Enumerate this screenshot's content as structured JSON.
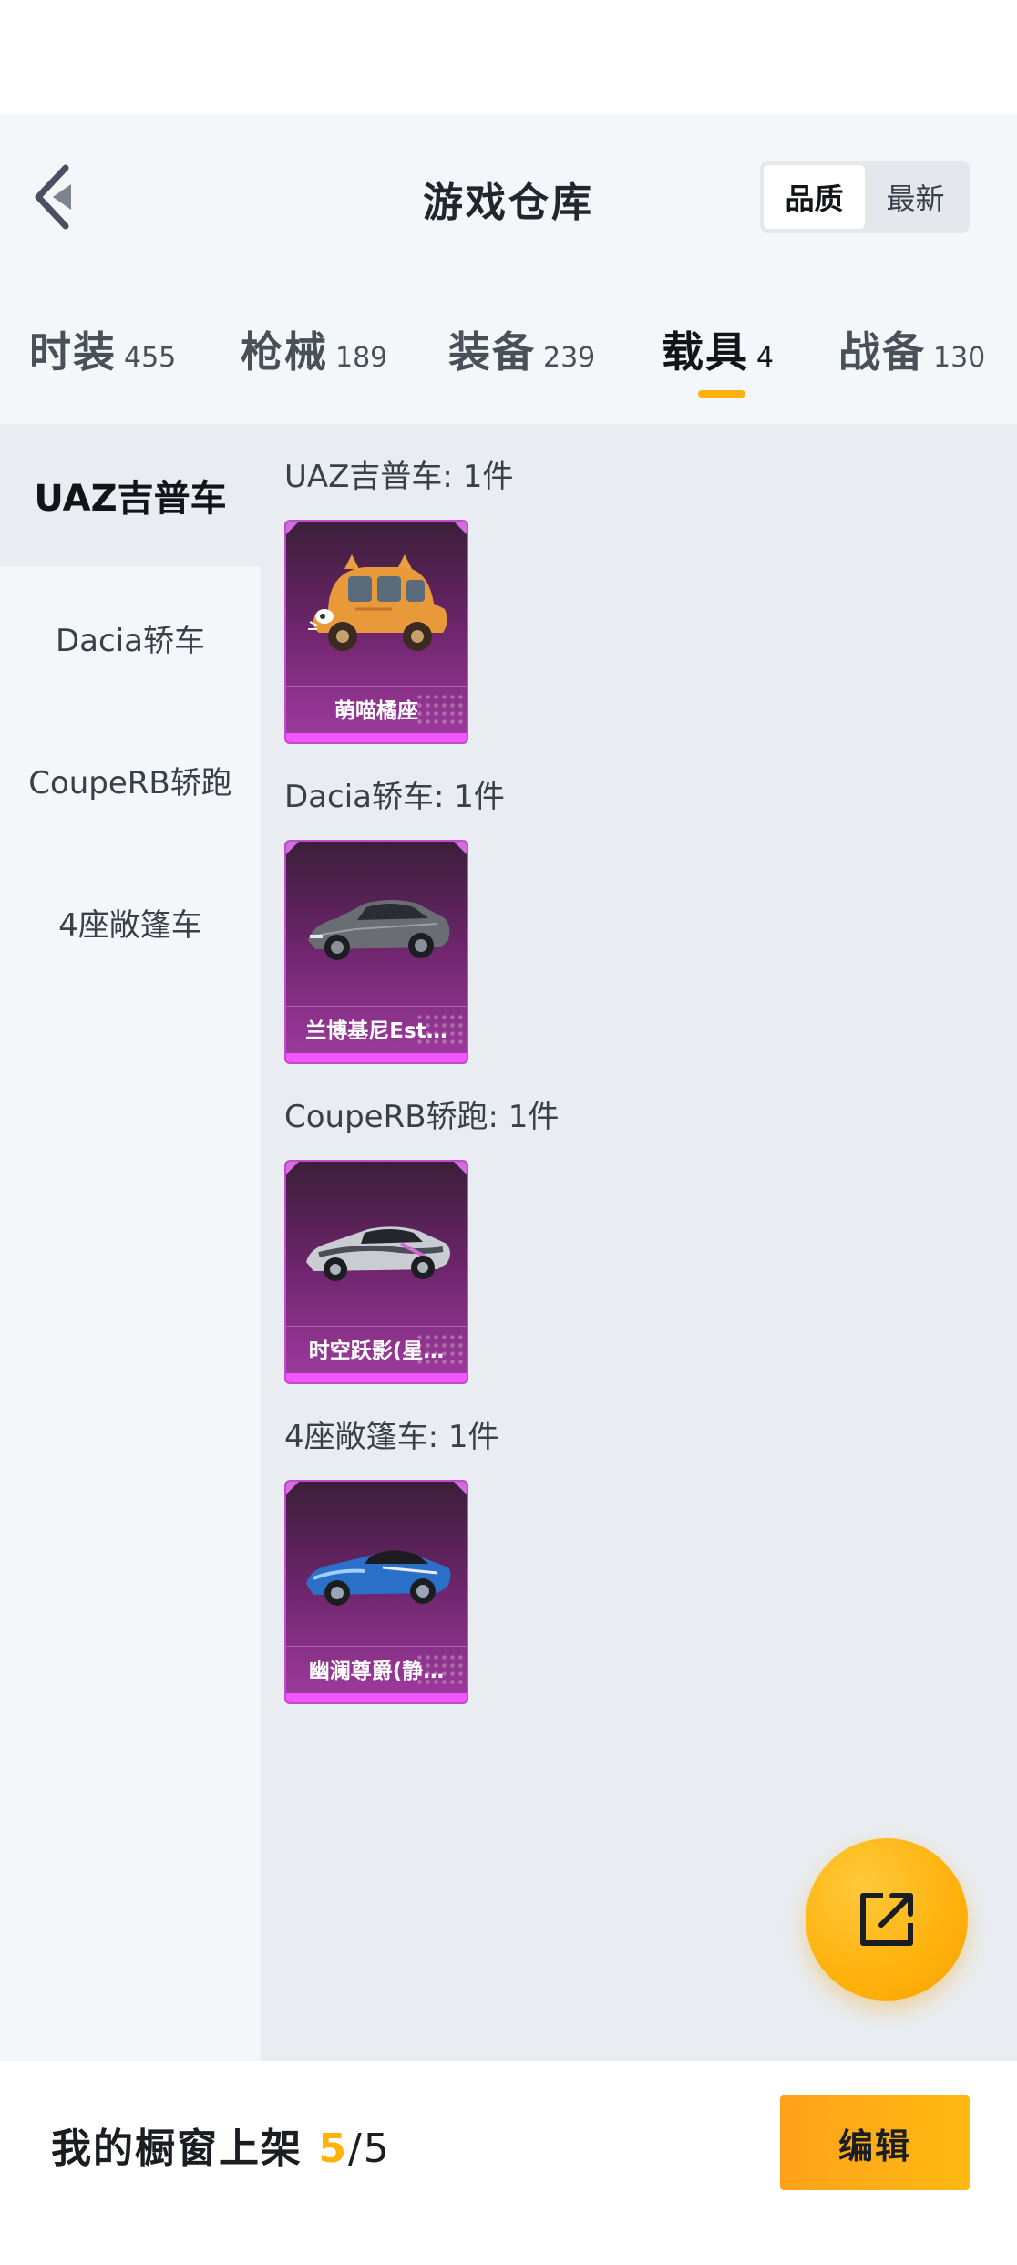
{
  "header": {
    "title": "游戏仓库",
    "sort_options": [
      "品质",
      "最新"
    ],
    "sort_selected": "品质"
  },
  "tabs": [
    {
      "label": "时装",
      "count": "455"
    },
    {
      "label": "枪械",
      "count": "189"
    },
    {
      "label": "装备",
      "count": "239"
    },
    {
      "label": "载具",
      "count": "4"
    },
    {
      "label": "战备",
      "count": "130"
    }
  ],
  "active_tab": "载具",
  "sidebar": {
    "items": [
      "UAZ吉普车",
      "Dacia轿车",
      "CoupeRB轿跑",
      "4座敞篷车"
    ],
    "active": "UAZ吉普车"
  },
  "groups": [
    {
      "title": "UAZ吉普车: 1件",
      "item_name": "萌喵橘座",
      "car_icon": "orange-cat-car-icon"
    },
    {
      "title": "Dacia轿车: 1件",
      "item_name": "兰博基尼Est…",
      "car_icon": "grey-sports-car-icon"
    },
    {
      "title": "CoupeRB轿跑: 1件",
      "item_name": "时空跃影(星…",
      "car_icon": "silver-supercar-icon"
    },
    {
      "title": "4座敞篷车: 1件",
      "item_name": "幽澜尊爵(静…",
      "car_icon": "blue-convertible-icon"
    }
  ],
  "showcase": {
    "label": "我的橱窗上架 ",
    "current": "5",
    "total": "/5",
    "edit_label": "编辑"
  },
  "colors": {
    "accent": "#ffb10c",
    "card_bar": "#f157ff",
    "card_bg": "#6a2468"
  }
}
